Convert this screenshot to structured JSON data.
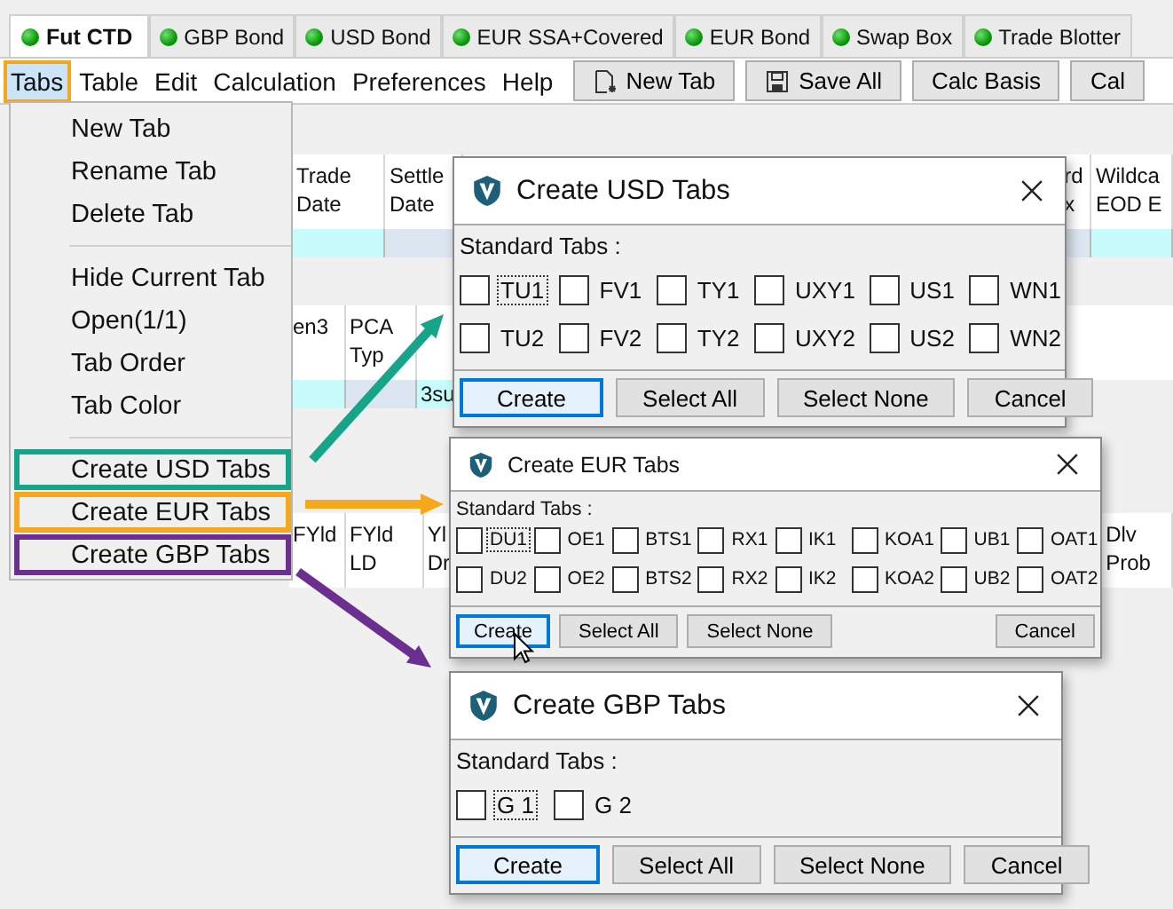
{
  "tabs": [
    {
      "label": "Fut CTD",
      "selected": true
    },
    {
      "label": "GBP Bond",
      "selected": false
    },
    {
      "label": "USD Bond",
      "selected": false
    },
    {
      "label": "EUR SSA+Covered",
      "selected": false
    },
    {
      "label": "EUR Bond",
      "selected": false
    },
    {
      "label": "Swap Box",
      "selected": false
    },
    {
      "label": "Trade Blotter",
      "selected": false
    }
  ],
  "menu_bar": [
    {
      "label": "Tabs",
      "selected": true
    },
    {
      "label": "Table",
      "selected": false
    },
    {
      "label": "Edit",
      "selected": false
    },
    {
      "label": "Calculation",
      "selected": false
    },
    {
      "label": "Preferences",
      "selected": false
    },
    {
      "label": "Help",
      "selected": false
    }
  ],
  "toolbar_buttons": [
    {
      "label": "New Tab",
      "kind": "new"
    },
    {
      "label": "Save All",
      "kind": "save"
    },
    {
      "label": "Calc Basis",
      "kind": "plain"
    },
    {
      "label": "Cal",
      "kind": "plain"
    }
  ],
  "table_bands": [
    {
      "data_row": true,
      "columns": [
        {
          "kind": "column",
          "header": "Trade Date"
        },
        {
          "kind": "column",
          "header": "Settle Date"
        },
        {
          "kind": "blank"
        },
        {
          "kind": "column",
          "header": "rd x"
        },
        {
          "kind": "column",
          "header": "Wildca EOD E"
        }
      ]
    },
    {
      "data_row": true,
      "columns": [
        {
          "kind": "column",
          "header": "en3"
        },
        {
          "kind": "column",
          "header": "PCA Typ"
        },
        {
          "kind": "column",
          "cell": "3su"
        },
        {
          "kind": "blank"
        }
      ]
    },
    {
      "data_row": false,
      "columns": [
        {
          "kind": "column",
          "header": "FYld"
        },
        {
          "kind": "column",
          "header": "FYld LD"
        },
        {
          "kind": "column",
          "header": "Yl Dr"
        },
        {
          "kind": "blank"
        },
        {
          "kind": "column",
          "header": "Dlv Prob"
        }
      ]
    }
  ],
  "dropdown": [
    {
      "kind": "item",
      "label": "New Tab"
    },
    {
      "kind": "item",
      "label": "Rename Tab"
    },
    {
      "kind": "item",
      "label": "Delete Tab"
    },
    {
      "kind": "separator"
    },
    {
      "kind": "item",
      "label": "Hide Current Tab"
    },
    {
      "kind": "item",
      "label": "Open(1/1)"
    },
    {
      "kind": "item",
      "label": "Tab Order"
    },
    {
      "kind": "item",
      "label": "Tab Color"
    },
    {
      "kind": "separator"
    },
    {
      "kind": "item",
      "label": "Create USD Tabs",
      "color": "#17a58a"
    },
    {
      "kind": "item",
      "label": "Create EUR Tabs",
      "color": "#f5a81c"
    },
    {
      "kind": "item",
      "label": "Create GBP Tabs",
      "color": "#6b2f8f"
    }
  ],
  "dialogs": [
    {
      "kind": "regular",
      "title": "Create USD Tabs",
      "section_label": "Standard Tabs :",
      "rows": [
        [
          {
            "label": "TU1",
            "checked": false,
            "focused": true
          },
          {
            "label": "FV1",
            "checked": false,
            "focused": false
          },
          {
            "label": "TY1",
            "checked": false,
            "focused": false
          },
          {
            "label": "UXY1",
            "checked": false,
            "focused": false
          },
          {
            "label": "US1",
            "checked": false,
            "focused": false
          },
          {
            "label": "WN1",
            "checked": false,
            "focused": false
          }
        ],
        [
          {
            "label": "TU2",
            "checked": false,
            "focused": false
          },
          {
            "label": "FV2",
            "checked": false,
            "focused": false
          },
          {
            "label": "TY2",
            "checked": false,
            "focused": false
          },
          {
            "label": "UXY2",
            "checked": false,
            "focused": false
          },
          {
            "label": "US2",
            "checked": false,
            "focused": false
          },
          {
            "label": "WN2",
            "checked": false,
            "focused": false
          }
        ]
      ],
      "buttons": [
        {
          "label": "Create",
          "default": true
        },
        {
          "label": "Select All",
          "default": false
        },
        {
          "label": "Select None",
          "default": false
        },
        {
          "label": "Cancel",
          "default": false
        }
      ]
    },
    {
      "kind": "compact",
      "title": "Create EUR Tabs",
      "section_label": "Standard Tabs :",
      "rows": [
        [
          {
            "label": "DU1",
            "checked": false,
            "focused": true
          },
          {
            "label": "OE1",
            "checked": false,
            "focused": false
          },
          {
            "label": "BTS1",
            "checked": false,
            "focused": false
          },
          {
            "label": "RX1",
            "checked": false,
            "focused": false
          },
          {
            "label": "IK1",
            "checked": false,
            "focused": false
          },
          {
            "label": "KOA1",
            "checked": false,
            "focused": false
          },
          {
            "label": "UB1",
            "checked": false,
            "focused": false
          },
          {
            "label": "OAT1",
            "checked": false,
            "focused": false
          }
        ],
        [
          {
            "label": "DU2",
            "checked": false,
            "focused": false
          },
          {
            "label": "OE2",
            "checked": false,
            "focused": false
          },
          {
            "label": "BTS2",
            "checked": false,
            "focused": false
          },
          {
            "label": "RX2",
            "checked": false,
            "focused": false
          },
          {
            "label": "IK2",
            "checked": false,
            "focused": false
          },
          {
            "label": "KOA2",
            "checked": false,
            "focused": false
          },
          {
            "label": "UB2",
            "checked": false,
            "focused": false
          },
          {
            "label": "OAT2",
            "checked": false,
            "focused": false
          }
        ]
      ],
      "buttons": [
        {
          "label": "Create",
          "default": true
        },
        {
          "label": "Select All",
          "default": false
        },
        {
          "label": "Select None",
          "default": false
        },
        {
          "label": "Cancel",
          "default": false
        }
      ]
    },
    {
      "kind": "regular",
      "title": "Create GBP Tabs",
      "section_label": "Standard Tabs :",
      "rows": [
        [
          {
            "label": "G 1",
            "checked": false,
            "focused": true
          },
          {
            "label": "G 2",
            "checked": false,
            "focused": false
          }
        ]
      ],
      "buttons": [
        {
          "label": "Create",
          "default": true
        },
        {
          "label": "Select All",
          "default": false
        },
        {
          "label": "Select None",
          "default": false
        },
        {
          "label": "Cancel",
          "default": false
        }
      ]
    }
  ]
}
